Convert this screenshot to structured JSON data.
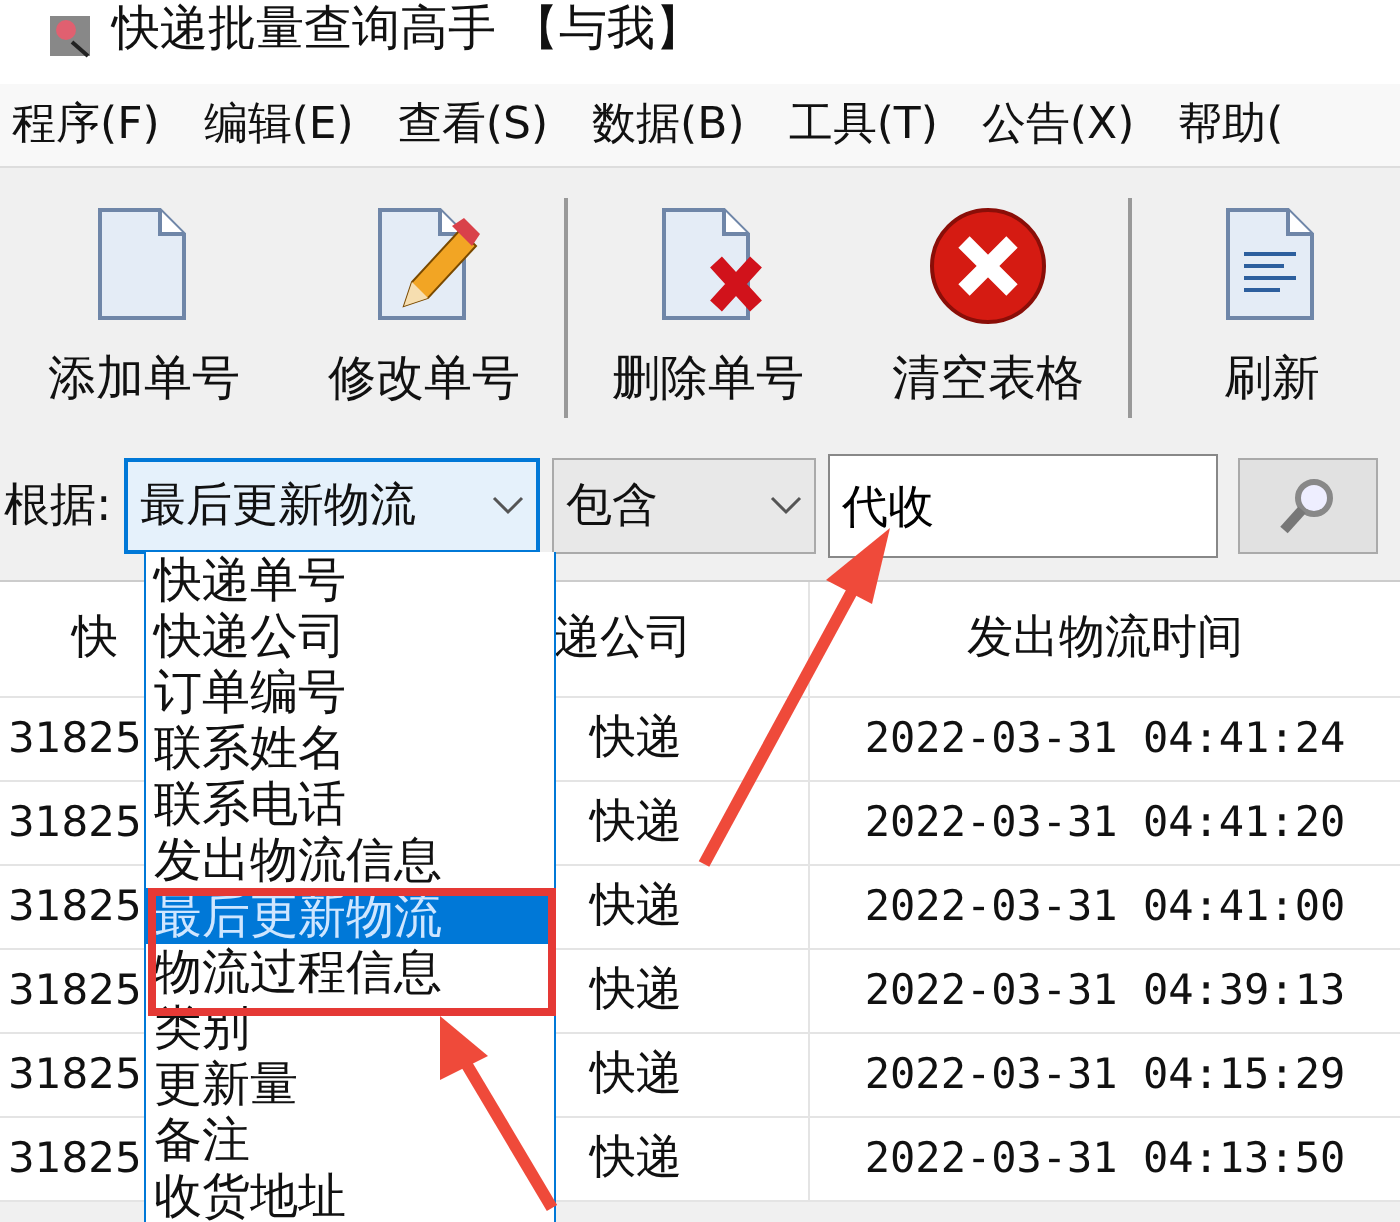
{
  "window": {
    "title": "快递批量查询高手 【与我】"
  },
  "menu": [
    "程序(F)",
    "编辑(E)",
    "查看(S)",
    "数据(B)",
    "工具(T)",
    "公告(X)",
    "帮助("
  ],
  "toolbar": [
    {
      "kind": "add",
      "label": "添加单号"
    },
    {
      "kind": "edit",
      "label": "修改单号"
    },
    {
      "kind": "separator"
    },
    {
      "kind": "delete",
      "label": "删除单号"
    },
    {
      "kind": "clear",
      "label": "清空表格"
    },
    {
      "kind": "separator"
    },
    {
      "kind": "refresh",
      "label": "刷新"
    }
  ],
  "search": {
    "label": "根据:",
    "field": {
      "value": "最后更新物流",
      "expanded": true
    },
    "match": {
      "value": "包含"
    },
    "query": {
      "value": "代收"
    }
  },
  "field_options": [
    {
      "label": "快递单号",
      "selected": false
    },
    {
      "label": "快递公司",
      "selected": false
    },
    {
      "label": "订单编号",
      "selected": false
    },
    {
      "label": "联系姓名",
      "selected": false
    },
    {
      "label": "联系电话",
      "selected": false
    },
    {
      "label": "发出物流信息",
      "selected": false
    },
    {
      "label": "最后更新物流",
      "selected": true
    },
    {
      "label": "物流过程信息",
      "selected": false
    },
    {
      "label": "类别",
      "selected": false
    },
    {
      "label": "更新量",
      "selected": false
    },
    {
      "label": "备注",
      "selected": false
    },
    {
      "label": "收货地址",
      "selected": false
    }
  ],
  "table": {
    "columns": [
      "快",
      "递公司",
      "发出物流时间"
    ],
    "rows": [
      [
        "31825",
        "快递",
        "2022-03-31  04:41:24"
      ],
      [
        "31825",
        "快递",
        "2022-03-31  04:41:20"
      ],
      [
        "31825",
        "快递",
        "2022-03-31  04:41:00"
      ],
      [
        "31825",
        "快递",
        "2022-03-31  04:39:13"
      ],
      [
        "31825",
        "快递",
        "2022-03-31  04:15:29"
      ],
      [
        "31825",
        "快递",
        "2022-03-31  04:13:50"
      ]
    ]
  }
}
